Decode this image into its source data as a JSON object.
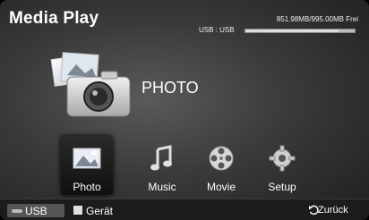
{
  "header": {
    "title": "Media Play",
    "storage_text": "851.98MB/995.00MB Frei",
    "source_label": "USB : USB",
    "storage_used_fraction": 0.856
  },
  "hero": {
    "label": "PHOTO",
    "icon": "camera-photos-icon"
  },
  "menu": {
    "items": [
      {
        "label": "Photo",
        "icon": "photo-icon",
        "selected": true
      },
      {
        "label": "Music",
        "icon": "music-note-icon",
        "selected": false
      },
      {
        "label": "Movie",
        "icon": "film-reel-icon",
        "selected": false
      },
      {
        "label": "Setup",
        "icon": "gear-icon",
        "selected": false
      }
    ]
  },
  "footer": {
    "usb_label": "USB",
    "device_label": "Gerät",
    "back_label": "Zurück",
    "colors": {
      "device_button": "#e0e0e0"
    }
  }
}
